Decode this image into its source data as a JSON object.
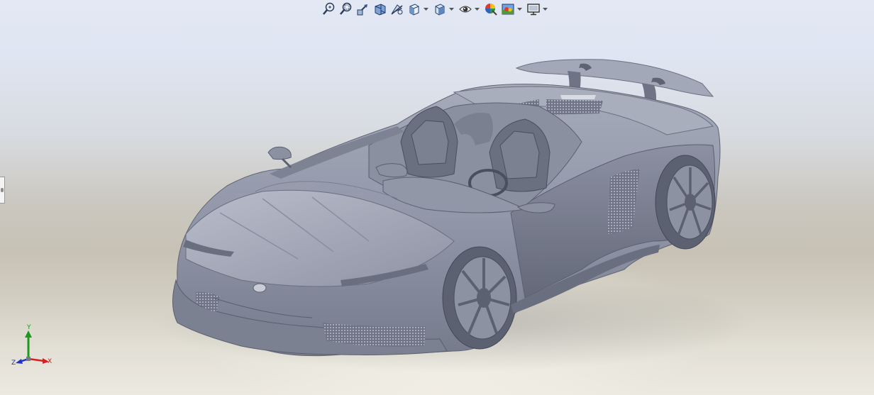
{
  "toolbar": {
    "items": [
      {
        "name": "zoom-to-fit-icon",
        "dropdown": false
      },
      {
        "name": "zoom-to-area-icon",
        "dropdown": false
      },
      {
        "name": "previous-view-icon",
        "dropdown": false
      },
      {
        "name": "section-view-icon",
        "dropdown": false
      },
      {
        "name": "dynamic-annotation-views-icon",
        "dropdown": false
      },
      {
        "name": "view-orientation-icon",
        "dropdown": true
      },
      {
        "name": "display-style-icon",
        "dropdown": true
      },
      {
        "name": "hide-show-items-icon",
        "dropdown": true
      },
      {
        "name": "edit-appearance-icon",
        "dropdown": false
      },
      {
        "name": "apply-scene-icon",
        "dropdown": true
      },
      {
        "name": "view-settings-icon",
        "dropdown": true
      }
    ]
  },
  "triad": {
    "x_label": "X",
    "y_label": "Y",
    "z_label": "Z",
    "x_color": "#d42020",
    "y_color": "#1c9a1c",
    "z_color": "#2030c8"
  },
  "colors": {
    "model_base": "#8f94a6",
    "model_light": "#b7bccb",
    "model_dark": "#5b6070"
  }
}
